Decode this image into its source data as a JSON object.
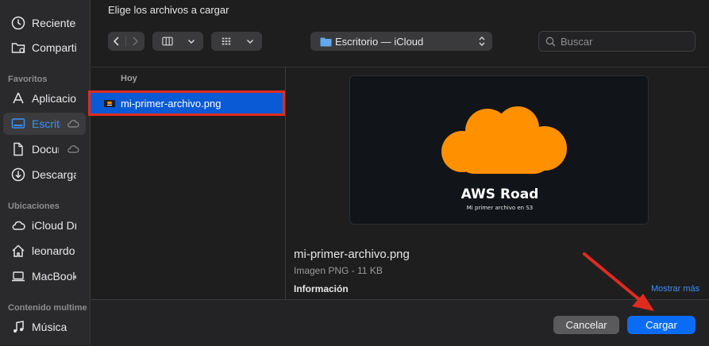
{
  "dialog": {
    "title": "Elige los archivos a cargar"
  },
  "sidebar": {
    "items_top": [
      {
        "label": "Recientes",
        "icon": "clock-icon"
      },
      {
        "label": "Compartido",
        "icon": "shared-folder-icon"
      }
    ],
    "favorites_header": "Favoritos",
    "favorites": [
      {
        "label": "Aplicaciones",
        "icon": "apps-icon"
      },
      {
        "label": "Escritorio",
        "icon": "desktop-icon",
        "active": true
      },
      {
        "label": "Documentos",
        "icon": "document-icon"
      },
      {
        "label": "Descargas",
        "icon": "download-icon"
      }
    ],
    "locations_header": "Ubicaciones",
    "locations": [
      {
        "label": "iCloud Drive",
        "icon": "cloud-icon"
      },
      {
        "label": "leonardo",
        "icon": "home-icon"
      },
      {
        "label": "MacBook",
        "icon": "laptop-icon"
      }
    ],
    "media_header": "Contenido multimedia",
    "media": [
      {
        "label": "Música",
        "icon": "music-icon"
      }
    ]
  },
  "toolbar": {
    "location": "Escritorio — iCloud",
    "search_placeholder": "Buscar"
  },
  "browser": {
    "group_header": "Hoy",
    "selected_file": "mi-primer-archivo.png"
  },
  "preview": {
    "image_title": "AWS Road",
    "image_subtitle": "Mi primer archivo en S3",
    "cloud_color": "#ff9100",
    "file_name": "mi-primer-archivo.png",
    "file_kind": "Imagen PNG - 11 KB",
    "info_header": "Información",
    "more_link": "Mostrar más"
  },
  "footer": {
    "cancel_label": "Cancelar",
    "upload_label": "Cargar"
  },
  "colors": {
    "accent": "#0a6cf5",
    "selection": "#0a5ad6",
    "annotation_red": "#e02b1f"
  }
}
